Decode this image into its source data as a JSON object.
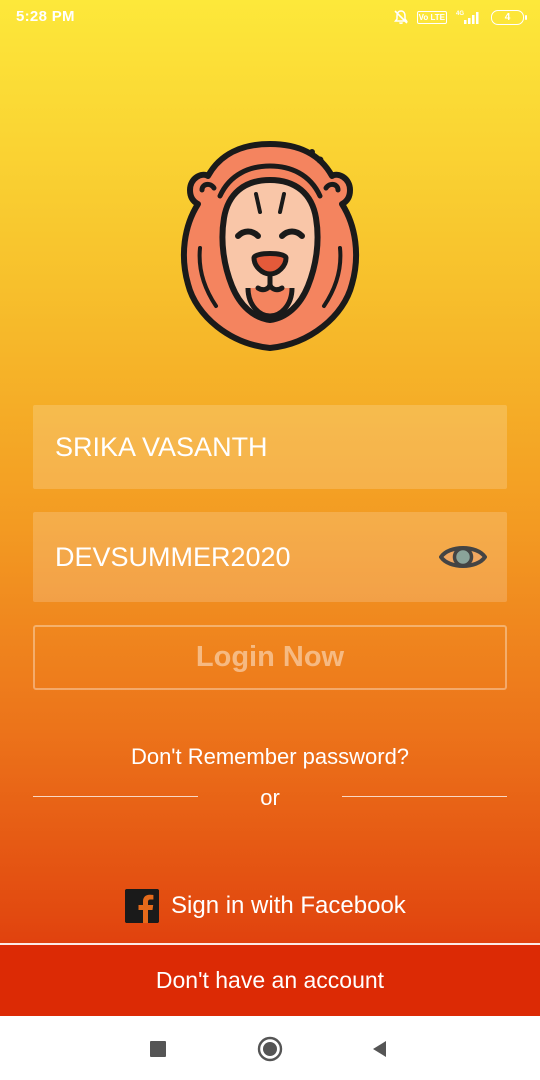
{
  "status_bar": {
    "time": "5:28 PM",
    "volte_badge": "Vo LTE",
    "network": "4G",
    "battery_level": "4"
  },
  "logo": {
    "icon": "lion-head-icon"
  },
  "login_form": {
    "username_value": "SRIKA VASANTH",
    "password_value": "DEVSUMMER2020",
    "show_password_icon": "eye-icon",
    "login_button_label": "Login Now",
    "forgot_password_link": "Don't Remember password?",
    "divider_text": "or"
  },
  "social": {
    "facebook_icon": "facebook-icon",
    "facebook_label": "Sign in with Facebook"
  },
  "footer": {
    "signup_label": "Don't have an account"
  },
  "nav": {
    "recents_icon": "square-icon",
    "home_icon": "circle-icon",
    "back_icon": "triangle-back-icon"
  },
  "colors": {
    "gradient_top": "#fde83a",
    "gradient_mid": "#f39a22",
    "gradient_bottom": "#dd2c08",
    "lion_mane": "#f4845f",
    "lion_face": "#f9c6a8",
    "outline": "#1a1a1a"
  }
}
